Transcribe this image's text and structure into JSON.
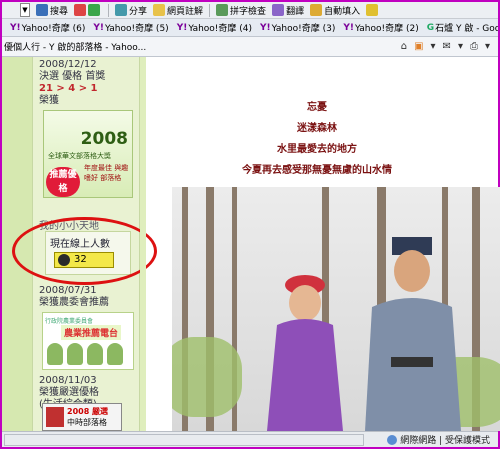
{
  "toolbar": {
    "search_label": "搜尋",
    "share_label": "分享",
    "bookmark_label": "網頁註解",
    "spellcheck_label": "拼字檢查",
    "translate_label": "翻譯",
    "autofill_label": "自動填入"
  },
  "yahoo_tabs": [
    {
      "label": "Yahoo!奇摩 (6)"
    },
    {
      "label": "Yahoo!奇摩 (5)"
    },
    {
      "label": "Yahoo!奇摩 (4)"
    },
    {
      "label": "Yahoo!奇摩 (3)"
    },
    {
      "label": "Yahoo!奇摩 (2)"
    },
    {
      "label": "石爐 Y 啟 - Google 搜尋"
    }
  ],
  "tab_title": "優個人行 - Y 啟的部落格 - Yahoo...",
  "sidebar": {
    "block1_date": "2008/12/12",
    "block1_title": "決選 優格 首獎",
    "block1_rank": "21 > 4 > 1",
    "block1_award": "榮獲",
    "badge1_year": "2008",
    "badge1_sub": "全球華文部落格大獎",
    "badge1_red": "推薦優格",
    "badge1_side": "年度最佳 與趣嗜好 部落格",
    "counter_section_title": "我的小小天地",
    "counter_label": "現在線上人數",
    "counter_value": "32",
    "block2_date": "2008/07/31",
    "block2_title": "榮獲農委會推薦",
    "badge2_top": "行政院農業委員會",
    "badge2_banner": "農業推薦電台",
    "block3_date": "2008/11/03",
    "block3_title": "榮獲嚴選優格",
    "block3_sub": "(生活綜合類)",
    "badge3_a": "2008 嚴選",
    "badge3_b": "中時部落格"
  },
  "poem": {
    "line1": "忘憂",
    "line2": "迷漾森林",
    "line3": "水里最愛去的地方",
    "line4": "今夏再去感受那無憂無慮的山水情"
  },
  "status_bar": {
    "zone_label": "網際網路 | 受保護模式"
  }
}
